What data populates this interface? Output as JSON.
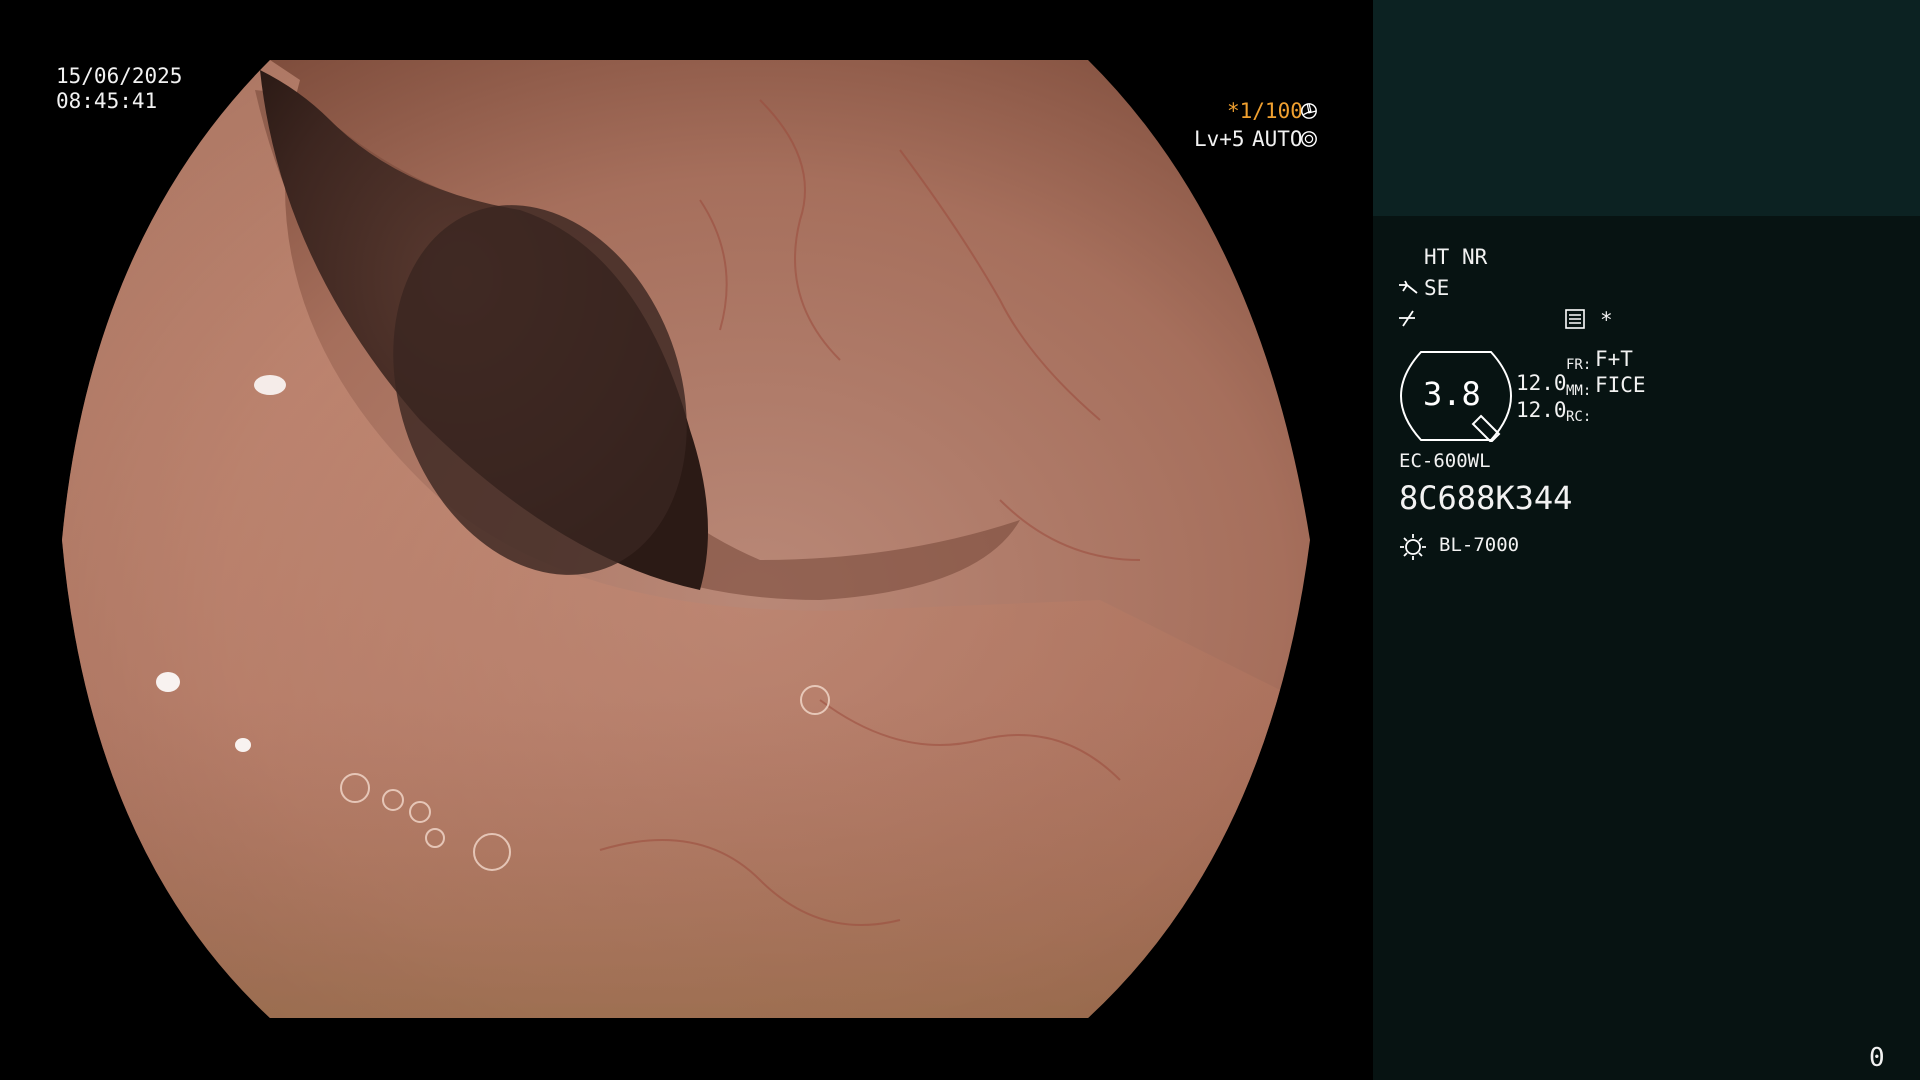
{
  "overlay": {
    "date": "15/06/2025",
    "time": "08:45:41",
    "shutter": "*1/100",
    "level": "Lv+5",
    "iris": "AUTO"
  },
  "panel": {
    "ht": "HT",
    "nr": "NR",
    "se": "SE",
    "asterisk": "*",
    "zoom": "3.8",
    "val1": "12.0",
    "val2": "12.0",
    "fr_label": "FR:",
    "fr_value": "F+T",
    "mm_label": "MM:",
    "mm_value": "FICE",
    "rc_label": "RC:",
    "scope_model": "EC-600WL",
    "serial": "8C688K344",
    "light_source": "BL-7000",
    "counter": "0"
  },
  "colors": {
    "accent_orange": "#f0a030",
    "panel_bg": "#071312",
    "panel_top_bg": "#0c2222"
  }
}
